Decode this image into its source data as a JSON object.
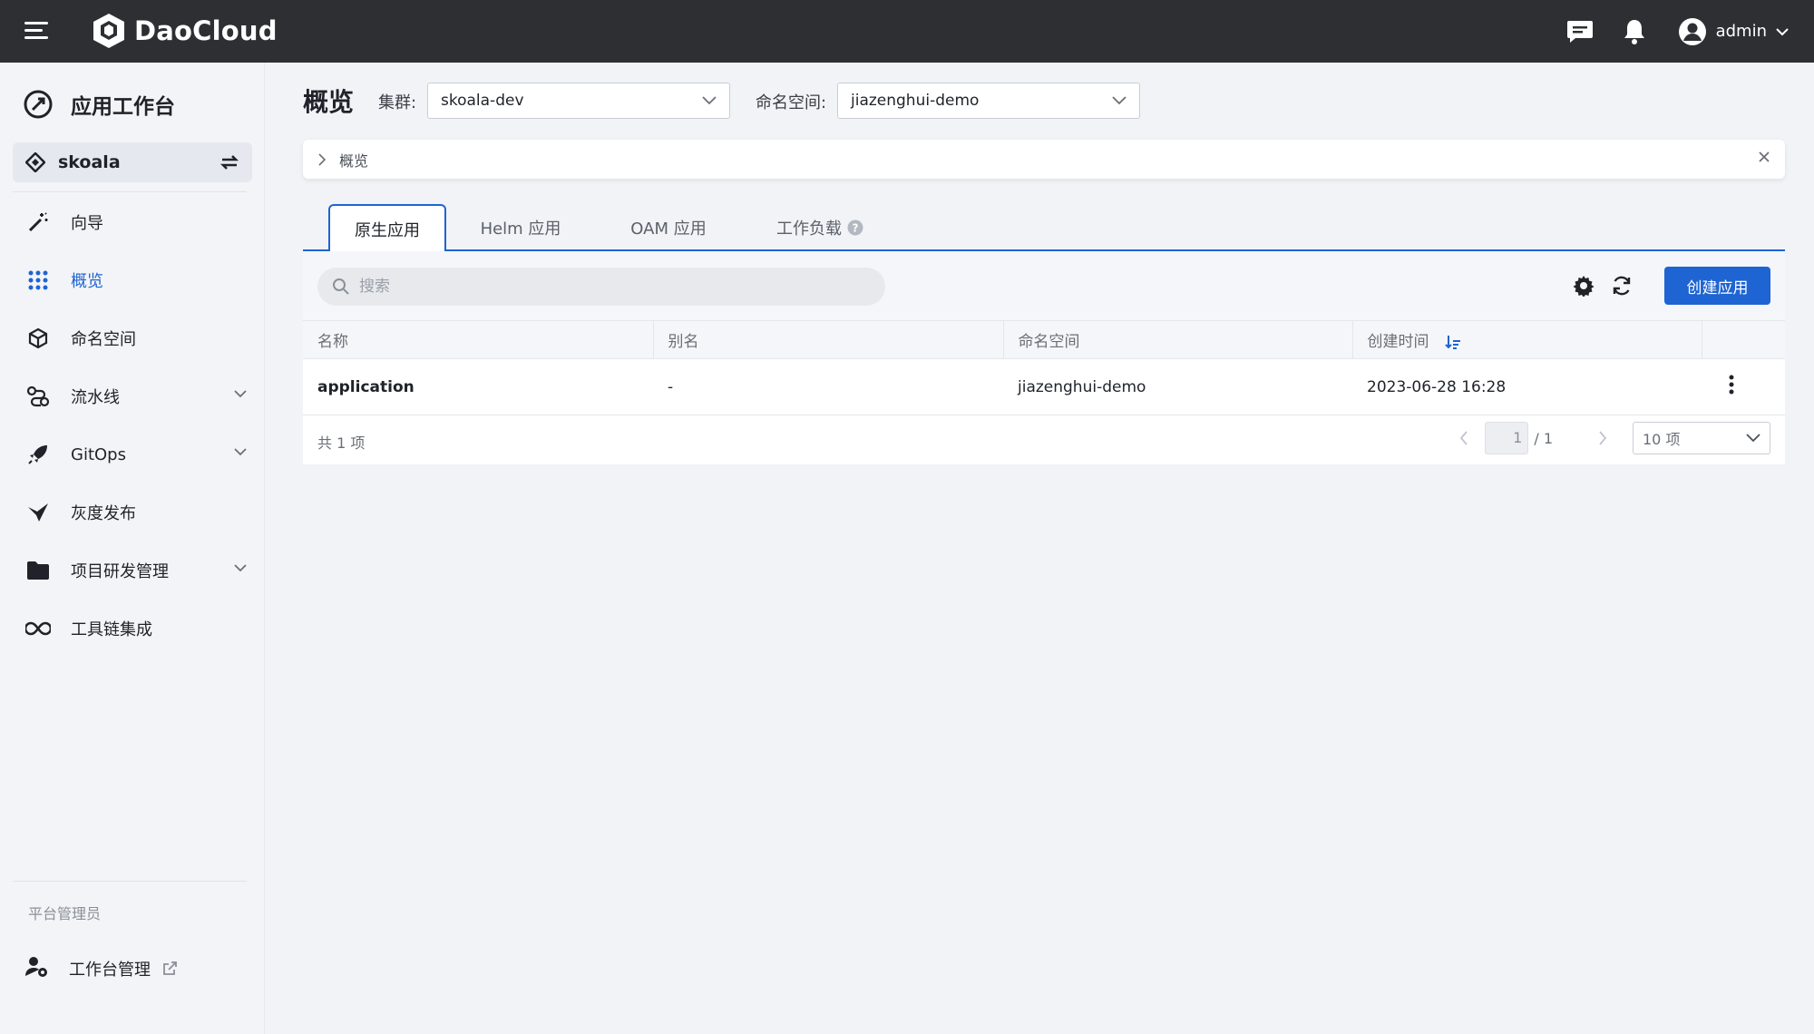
{
  "app": {
    "brand": "DaoCloud",
    "accent": "#1e64d2"
  },
  "topbar": {
    "user": "admin"
  },
  "sidebar": {
    "title": "应用工作台",
    "workspace": "skoala",
    "items": [
      {
        "label": "向导"
      },
      {
        "label": "概览"
      },
      {
        "label": "命名空间"
      },
      {
        "label": "流水线"
      },
      {
        "label": "GitOps"
      },
      {
        "label": "灰度发布"
      },
      {
        "label": "项目研发管理"
      },
      {
        "label": "工具链集成"
      }
    ],
    "footer_label": "平台管理员",
    "footer_item": "工作台管理"
  },
  "main": {
    "title": "概览",
    "cluster_label": "集群:",
    "cluster_value": "skoala-dev",
    "namespace_label": "命名空间:",
    "namespace_value": "jiazenghui-demo",
    "breadcrumb": "概览",
    "tabs": [
      "原生应用",
      "Helm 应用",
      "OAM 应用",
      "工作负载"
    ],
    "search_placeholder": "搜索",
    "create_button": "创建应用",
    "table": {
      "columns": [
        "名称",
        "别名",
        "命名空间",
        "创建时间"
      ],
      "rows": [
        {
          "name": "application",
          "alias": "-",
          "namespace": "jiazenghui-demo",
          "created": "2023-06-28 16:28"
        }
      ]
    },
    "pagination": {
      "total": "共 1 项",
      "page": "1",
      "of": "/ 1",
      "page_size": "10 项"
    }
  }
}
